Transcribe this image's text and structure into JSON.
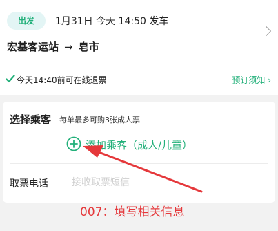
{
  "trip": {
    "badge": "出发",
    "depart_info": "1月31日 今天 14:50 发车",
    "from": "宏基客运站",
    "arrow": "→",
    "to": "皂市"
  },
  "refund": {
    "text": "今天14:40前可在线退票",
    "notice_link": "预订须知"
  },
  "passenger": {
    "title": "选择乘客",
    "subtitle": "每单最多可购3张成人票",
    "add_label": "添加乘客（成人/儿童）",
    "phone_label": "取票电话",
    "phone_placeholder": "接收取票短信",
    "phone_value": ""
  },
  "annotation": {
    "text": "007：填写相关信息"
  },
  "colors": {
    "accent_green": "#23b07a",
    "annotation_red": "#e5383b"
  }
}
